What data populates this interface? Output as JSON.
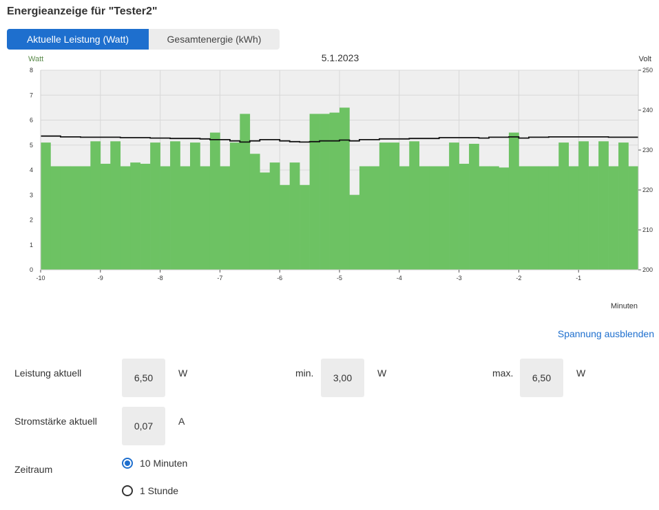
{
  "page": {
    "title": "Energieanzeige für \"Tester2\""
  },
  "tabs": [
    {
      "label": "Aktuelle Leistung (Watt)",
      "active": true
    },
    {
      "label": "Gesamtenergie (kWh)",
      "active": false
    }
  ],
  "chart_data": {
    "type": "bar",
    "title": "5.1.2023",
    "xlabel": "Minuten",
    "ylabel": "Watt",
    "ylabel_right": "Volt",
    "xlim": [
      -10,
      0
    ],
    "ylim": [
      0,
      8
    ],
    "ylim_right": [
      200,
      250
    ],
    "x_ticks": [
      "-10",
      "-9",
      "-8",
      "-7",
      "-6",
      "-5",
      "-4",
      "-3",
      "-2",
      "-1"
    ],
    "y_ticks": [
      "0",
      "1",
      "2",
      "3",
      "4",
      "5",
      "6",
      "7",
      "8"
    ],
    "y_ticks_right": [
      "200",
      "210",
      "220",
      "230",
      "240",
      "250"
    ],
    "grid": true,
    "bar_color": "#6dc263",
    "line_color": "#111111",
    "series": [
      {
        "values": [
          5.1,
          4.15,
          4.15,
          4.15,
          4.15,
          5.15,
          4.25,
          5.15,
          4.15,
          4.3,
          4.25,
          5.1,
          4.15,
          5.15,
          4.15,
          5.1,
          4.15,
          5.5,
          4.15,
          5.1,
          6.25,
          4.65,
          3.9,
          4.3,
          3.4,
          4.3,
          3.4,
          6.25,
          6.25,
          6.3,
          6.5,
          3.0,
          4.15,
          4.15,
          5.1,
          5.1,
          4.15,
          5.15,
          4.15,
          4.15,
          4.15,
          5.1,
          4.25,
          5.05,
          4.15,
          4.15,
          4.1,
          5.5,
          4.15,
          4.15,
          4.15,
          4.15,
          5.1,
          4.15,
          5.15,
          4.15,
          5.15,
          4.15,
          5.1,
          4.15
        ]
      },
      {
        "values": [
          233.5,
          233.5,
          233.3,
          233.3,
          233.2,
          233.2,
          233.2,
          233.2,
          233.1,
          233.1,
          233.1,
          233.0,
          233.0,
          232.9,
          232.9,
          232.9,
          232.8,
          232.6,
          232.6,
          232.3,
          232.0,
          232.3,
          232.6,
          232.6,
          232.3,
          232.1,
          232.0,
          232.1,
          232.3,
          232.3,
          232.5,
          232.3,
          232.6,
          232.6,
          232.8,
          232.8,
          232.8,
          232.9,
          232.9,
          232.9,
          233.1,
          233.1,
          233.1,
          233.1,
          233.0,
          233.2,
          233.2,
          233.3,
          233.0,
          233.2,
          233.2,
          233.3,
          233.3,
          233.3,
          233.3,
          233.3,
          233.3,
          233.2,
          233.2,
          233.2
        ]
      }
    ]
  },
  "spannung_link": "Spannung ausblenden",
  "measurements": {
    "leistung_label": "Leistung aktuell",
    "leistung_value": "6,50",
    "leistung_unit": "W",
    "min_label": "min.",
    "min_value": "3,00",
    "min_unit": "W",
    "max_label": "max.",
    "max_value": "6,50",
    "max_unit": "W",
    "strom_label": "Stromstärke aktuell",
    "strom_value": "0,07",
    "strom_unit": "A"
  },
  "zeitraum": {
    "label": "Zeitraum",
    "options": [
      {
        "label": "10 Minuten",
        "checked": true
      },
      {
        "label": "1 Stunde",
        "checked": false
      }
    ]
  }
}
